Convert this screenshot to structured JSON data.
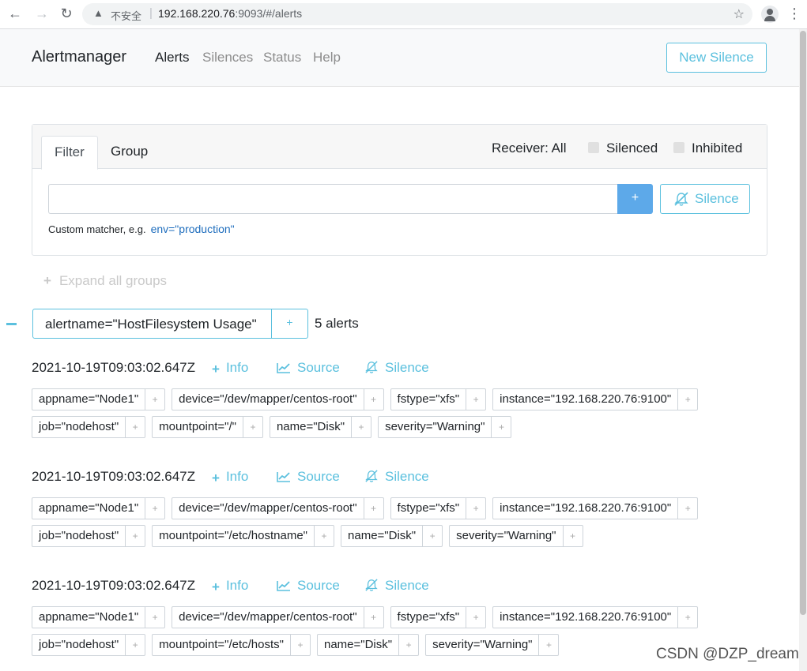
{
  "browser": {
    "security_label": "不安全",
    "url_host": "192.168.220.76",
    "url_rest": ":9093/#/alerts"
  },
  "navbar": {
    "brand": "Alertmanager",
    "links": [
      "Alerts",
      "Silences",
      "Status",
      "Help"
    ],
    "new_silence": "New Silence"
  },
  "filter": {
    "tabs": [
      "Filter",
      "Group"
    ],
    "receiver": "Receiver: All",
    "silenced": "Silenced",
    "inhibited": "Inhibited",
    "input_value": "",
    "plus": "+",
    "silence_button": "Silence",
    "hint": "Custom matcher, e.g.",
    "hint_example": "env=\"production\""
  },
  "expand_all": "Expand all groups",
  "group": {
    "label": "alertname=\"HostFilesystem Usage\"",
    "plus": "+",
    "count": "5 alerts"
  },
  "alert_actions": {
    "info": "Info",
    "source": "Source",
    "silence": "Silence"
  },
  "alerts": [
    {
      "timestamp": "2021-10-19T09:03:02.647Z",
      "labels_row1": [
        "appname=\"Node1\"",
        "device=\"/dev/mapper/centos-root\"",
        "fstype=\"xfs\"",
        "instance=\"192.168.220.76:9100\""
      ],
      "labels_row2": [
        "job=\"nodehost\"",
        "mountpoint=\"/\"",
        "name=\"Disk\"",
        "severity=\"Warning\""
      ]
    },
    {
      "timestamp": "2021-10-19T09:03:02.647Z",
      "labels_row1": [
        "appname=\"Node1\"",
        "device=\"/dev/mapper/centos-root\"",
        "fstype=\"xfs\"",
        "instance=\"192.168.220.76:9100\""
      ],
      "labels_row2": [
        "job=\"nodehost\"",
        "mountpoint=\"/etc/hostname\"",
        "name=\"Disk\"",
        "severity=\"Warning\""
      ]
    },
    {
      "timestamp": "2021-10-19T09:03:02.647Z",
      "labels_row1": [
        "appname=\"Node1\"",
        "device=\"/dev/mapper/centos-root\"",
        "fstype=\"xfs\"",
        "instance=\"192.168.220.76:9100\""
      ],
      "labels_row2": [
        "job=\"nodehost\"",
        "mountpoint=\"/etc/hosts\"",
        "name=\"Disk\"",
        "severity=\"Warning\""
      ]
    }
  ],
  "watermark": "CSDN @DZP_dream",
  "colors": {
    "accent": "#5bc0de",
    "primary": "#5da9e9",
    "link": "#1e6dbd"
  }
}
